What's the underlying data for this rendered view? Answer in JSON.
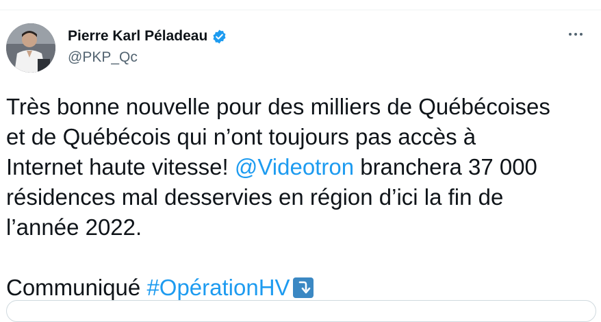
{
  "author": {
    "display_name": "Pierre Karl Péladeau",
    "handle": "@PKP_Qc",
    "verified": true
  },
  "tweet": {
    "line1": "Très bonne nouvelle pour des milliers de Québécoises",
    "line2": "et de Québécois qui n’ont toujours pas accès à",
    "line3_before": "Internet haute vitesse! ",
    "mention": "@Videotron",
    "line3_after": " branchera 37 000",
    "line4": "résidences mal desservies en région d’ici la fin de",
    "line5": "l’année 2022.",
    "footer_word": "Communiqué ",
    "hashtag": "#OpérationHV"
  },
  "icons": {
    "more": "more-options-icon",
    "verified": "verified-badge-icon",
    "arrow": "arrow-down-emoji"
  },
  "colors": {
    "link": "#1d9bf0",
    "verified": "#1d9bf0",
    "text": "#0f1419",
    "secondary": "#536471",
    "emoji_bg": "#3b88c3"
  }
}
